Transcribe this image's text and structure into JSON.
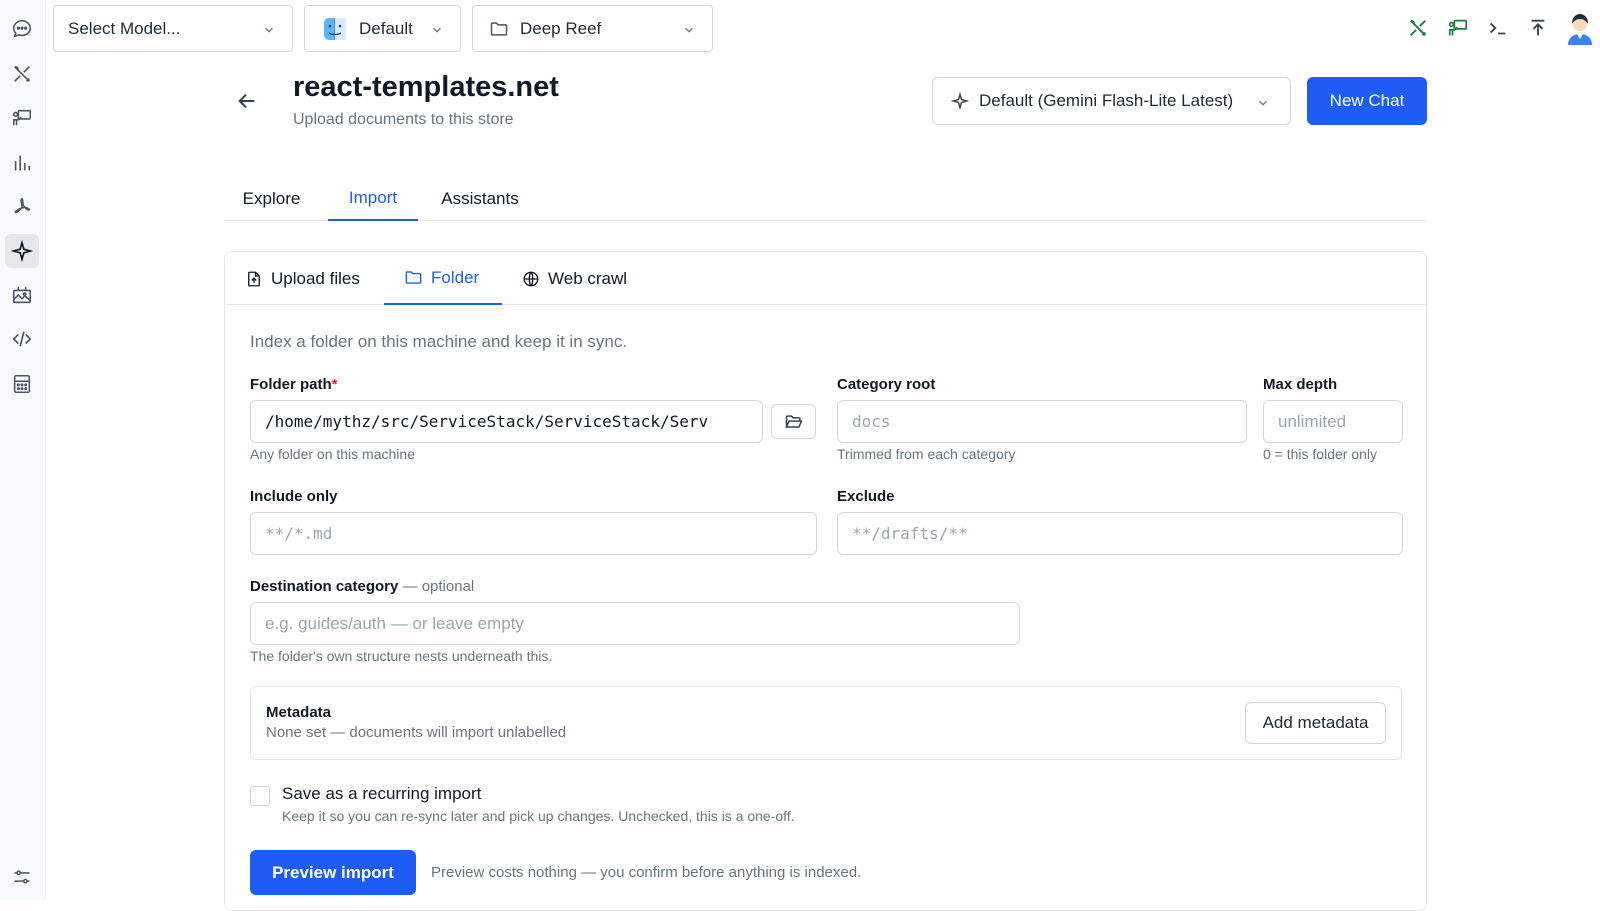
{
  "topbar": {
    "model_select": "Select Model...",
    "profile_select": "Default",
    "project_select": "Deep Reef"
  },
  "header": {
    "title": "react-templates.net",
    "subtitle": "Upload documents to this store",
    "model": "Default (Gemini Flash-Lite Latest)",
    "new_chat": "New Chat"
  },
  "tabs": [
    "Explore",
    "Import",
    "Assistants"
  ],
  "subtabs": [
    "Upload files",
    "Folder",
    "Web crawl"
  ],
  "form": {
    "intro": "Index a folder on this machine and keep it in sync.",
    "folder_path": {
      "label": "Folder path",
      "required": "*",
      "value": "/home/mythz/src/ServiceStack/ServiceStack/Serv",
      "hint": "Any folder on this machine"
    },
    "category_root": {
      "label": "Category root",
      "placeholder": "docs",
      "hint": "Trimmed from each category"
    },
    "max_depth": {
      "label": "Max depth",
      "placeholder": "unlimited",
      "hint": "0 = this folder only"
    },
    "include_only": {
      "label": "Include only",
      "placeholder": "**/*.md"
    },
    "exclude": {
      "label": "Exclude",
      "placeholder": "**/drafts/**"
    },
    "destination": {
      "label": "Destination category",
      "optional": " — optional",
      "placeholder": "e.g. guides/auth — or leave empty",
      "hint": "The folder's own structure nests underneath this."
    },
    "metadata": {
      "title": "Metadata",
      "desc": "None set — documents will import unlabelled",
      "button": "Add metadata"
    },
    "recurring": {
      "label": "Save as a recurring import",
      "desc": "Keep it so you can re-sync later and pick up changes. Unchecked, this is a one-off."
    },
    "preview_button": "Preview import",
    "preview_note": "Preview costs nothing — you confirm before anything is indexed."
  },
  "colors": {
    "accent": "#1d5cf5",
    "green_icons": "#15803d",
    "required": "#dc2626"
  }
}
